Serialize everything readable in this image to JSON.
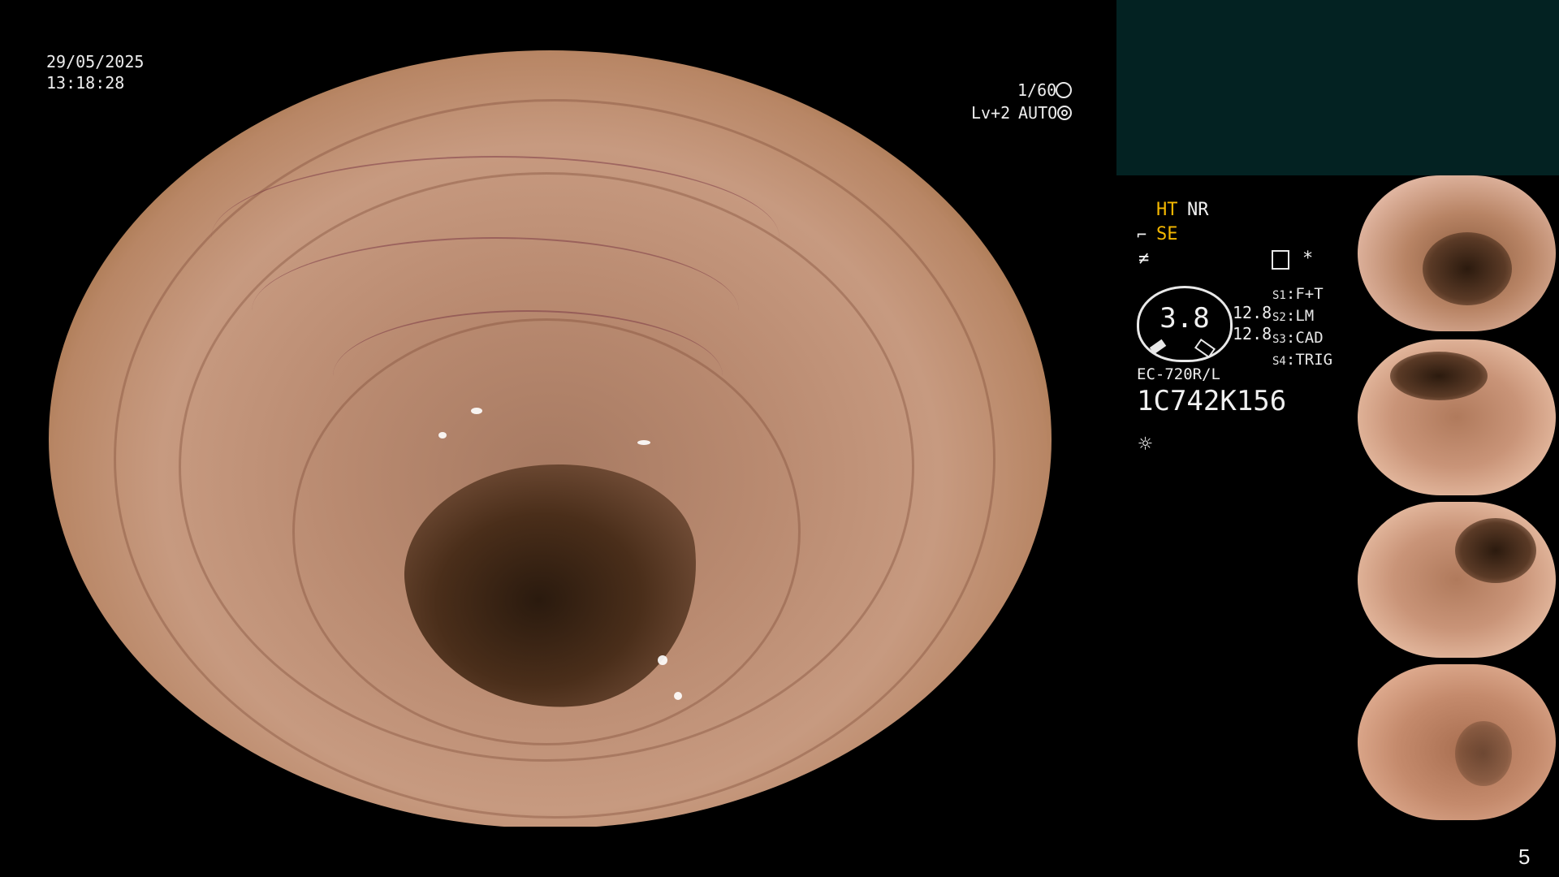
{
  "overlay": {
    "date": "29/05/2025",
    "time": "13:18:28",
    "shutter": "1/60",
    "level": "Lv+2",
    "exposure_mode": "AUTO"
  },
  "panel": {
    "ht": "HT",
    "nr": "NR",
    "se": "SE",
    "gauge_value": "3.8",
    "value_top": "12.8",
    "value_bottom": "12.8",
    "switches": [
      {
        "key": "S1",
        "value": "F+T"
      },
      {
        "key": "S2",
        "value": "LM"
      },
      {
        "key": "S3",
        "value": "CAD"
      },
      {
        "key": "S4",
        "value": "TRIG"
      }
    ],
    "scope_model": "EC-720R/L",
    "serial": "1C742K156",
    "asterisk": "*"
  },
  "page_number": "5",
  "icons": {
    "shutter_icon": "aperture-icon",
    "exposure_icon": "iris-icon",
    "light_icon": "sun-icon",
    "menu_icon": "list-icon"
  },
  "colors": {
    "accent_yellow": "#f5b800",
    "panel_teal": "#032222"
  }
}
